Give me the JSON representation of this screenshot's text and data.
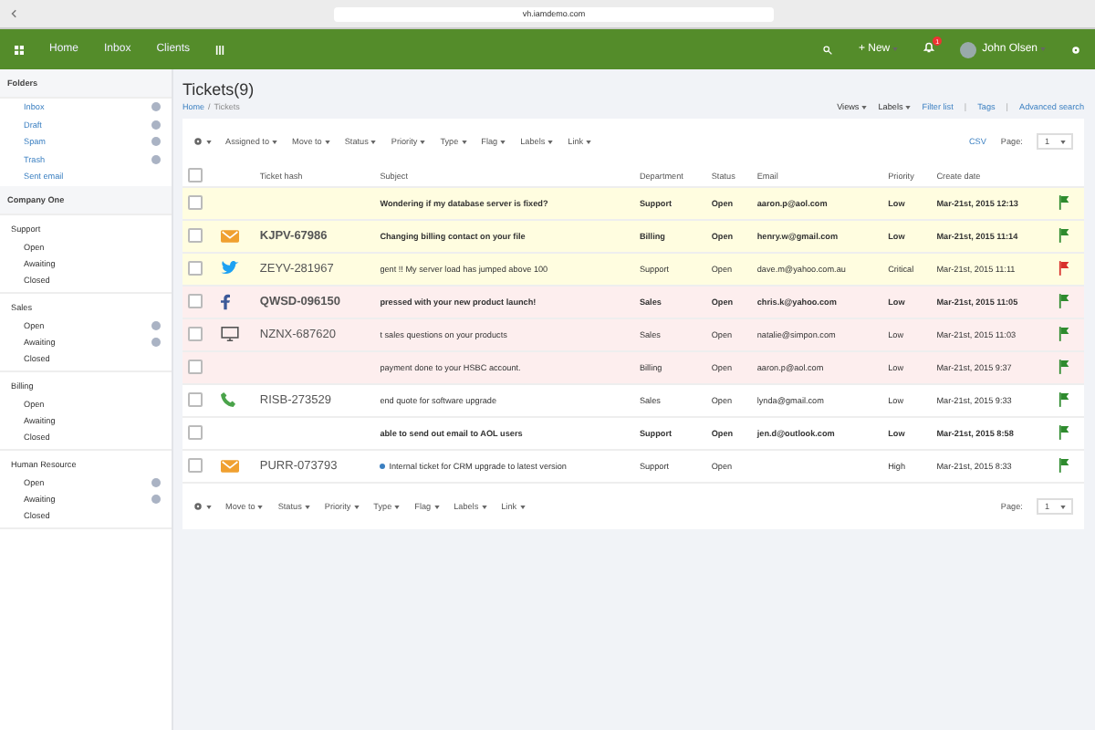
{
  "browser": {
    "url": "vh.iamdemo.com"
  },
  "nav": {
    "items": [
      "Home",
      "Inbox",
      "Clients"
    ],
    "new_label": "+ New",
    "notifications": "1",
    "user": "John Olsen"
  },
  "sidebar": {
    "folders_title": "Folders",
    "folders": [
      {
        "label": "Inbox",
        "badge": true
      },
      {
        "label": "Draft",
        "badge": true
      },
      {
        "label": "Spam",
        "badge": true
      },
      {
        "label": "Trash",
        "badge": true
      },
      {
        "label": "Sent email",
        "badge": false
      }
    ],
    "company": "Company One",
    "groups": [
      {
        "label": "Support",
        "items": [
          {
            "label": "Open",
            "badge": false
          },
          {
            "label": "Awaiting",
            "badge": false
          },
          {
            "label": "Closed",
            "badge": false
          }
        ]
      },
      {
        "label": "Sales",
        "items": [
          {
            "label": "Open",
            "badge": true
          },
          {
            "label": "Awaiting",
            "badge": true
          },
          {
            "label": "Closed",
            "badge": false
          }
        ]
      },
      {
        "label": "Billing",
        "items": [
          {
            "label": "Open",
            "badge": false
          },
          {
            "label": "Awaiting",
            "badge": false
          },
          {
            "label": "Closed",
            "badge": false
          }
        ]
      },
      {
        "label": "Human Resource",
        "items": [
          {
            "label": "Open",
            "badge": true
          },
          {
            "label": "Awaiting",
            "badge": true
          },
          {
            "label": "Closed",
            "badge": false
          }
        ]
      }
    ]
  },
  "page": {
    "title": "Tickets(9)",
    "breadcrumb": [
      "Home",
      "/",
      "Tickets"
    ],
    "menus": [
      "Views",
      "Labels"
    ],
    "links": [
      "Filter list",
      "|",
      "Tags",
      "|",
      "Advanced search"
    ]
  },
  "toolbar": {
    "filters": [
      "Assigned to",
      "Move to",
      "Status",
      "Priority",
      "Type",
      "Flag",
      "Labels",
      "Link"
    ],
    "csv": "CSV",
    "page_label": "Page:",
    "page": "1"
  },
  "bottom_toolbar": {
    "filters": [
      "Move to",
      "Status",
      "Priority",
      "Type",
      "Flag",
      "Labels",
      "Link"
    ],
    "page_label": "Page:",
    "page": "1"
  },
  "table": {
    "all_selected": false,
    "columns": [
      "Ticket hash",
      "Subject",
      "Department",
      "Status",
      "Email",
      "Priority",
      "Create date"
    ],
    "rows": [
      {
        "color": "#fffde0",
        "unread": true,
        "kind": "none",
        "subject": "Wondering if my database server is fixed?",
        "department": "Support",
        "status": "Open",
        "email": "aaron.p@aol.com",
        "priority": "Low",
        "date": "Mar-21st, 2015 12:13",
        "flag": {
          "color": "#2e8b2e"
        }
      },
      {
        "color": "#fffde0",
        "unread": true,
        "kind": "email",
        "hash": "KJPV-67986",
        "subject": "Changing billing contact on your file",
        "department": "Billing",
        "status": "Open",
        "email": "henry.w@gmail.com",
        "priority": "Low",
        "date": "Mar-21st, 2015 11:14",
        "flag": {
          "color": "#2e8b2e"
        }
      },
      {
        "color": "#fffde0",
        "unread": false,
        "kind": "twitter",
        "hash": "ZEYV-281967",
        "subject": "gent !! My server load has jumped above 100",
        "department": "Support",
        "status": "Open",
        "email": "dave.m@yahoo.com.au",
        "priority": "Critical",
        "date": "Mar-21st, 2015 11:11",
        "flag": {
          "color": "#d9302c"
        }
      },
      {
        "color": "#fdeeee",
        "unread": true,
        "kind": "facebook",
        "hash": "QWSD-096150",
        "subject": "pressed with your new product launch!",
        "department": "Sales",
        "status": "Open",
        "email": "chris.k@yahoo.com",
        "priority": "Low",
        "date": "Mar-21st, 2015 11:05",
        "flag": {
          "color": "#2e8b2e"
        }
      },
      {
        "color": "#fdeeee",
        "unread": false,
        "kind": "monitor",
        "hash": "NZNX-687620",
        "subject": "t sales questions on your products",
        "department": "Sales",
        "status": "Open",
        "email": "natalie@simpon.com",
        "priority": "Low",
        "date": "Mar-21st, 2015 11:03",
        "flag": {
          "color": "#2e8b2e"
        }
      },
      {
        "color": "#fdeeee",
        "unread": false,
        "kind": "none",
        "subject": "payment done to your HSBC account.",
        "department": "Billing",
        "status": "Open",
        "email": "aaron.p@aol.com",
        "priority": "Low",
        "date": "Mar-21st, 2015 9:37",
        "flag": {
          "color": "#2e8b2e"
        }
      },
      {
        "color": "#ffffff",
        "unread": false,
        "kind": "phone",
        "hash": "RISB-273529",
        "subject": "end quote for software upgrade",
        "department": "Sales",
        "status": "Open",
        "email": "lynda@gmail.com",
        "priority": "Low",
        "date": "Mar-21st, 2015 9:33",
        "flag": {
          "color": "#2e8b2e"
        }
      },
      {
        "color": "#ffffff",
        "unread": true,
        "kind": "none",
        "subject": "able to send out email to AOL users",
        "department": "Support",
        "status": "Open",
        "email": "jen.d@outlook.com",
        "priority": "Low",
        "date": "Mar-21st, 2015 8:58",
        "flag": {
          "color": "#2e8b2e"
        }
      },
      {
        "color": "#ffffff",
        "unread": false,
        "kind": "email",
        "hash": "PURR-073793",
        "internal": true,
        "subject": "Internal ticket for CRM upgrade to latest version",
        "department": "Support",
        "status": "Open",
        "priority": "High",
        "date": "Mar-21st, 2015 8:33",
        "flag": {
          "color": "#2e8b2e"
        }
      }
    ]
  }
}
